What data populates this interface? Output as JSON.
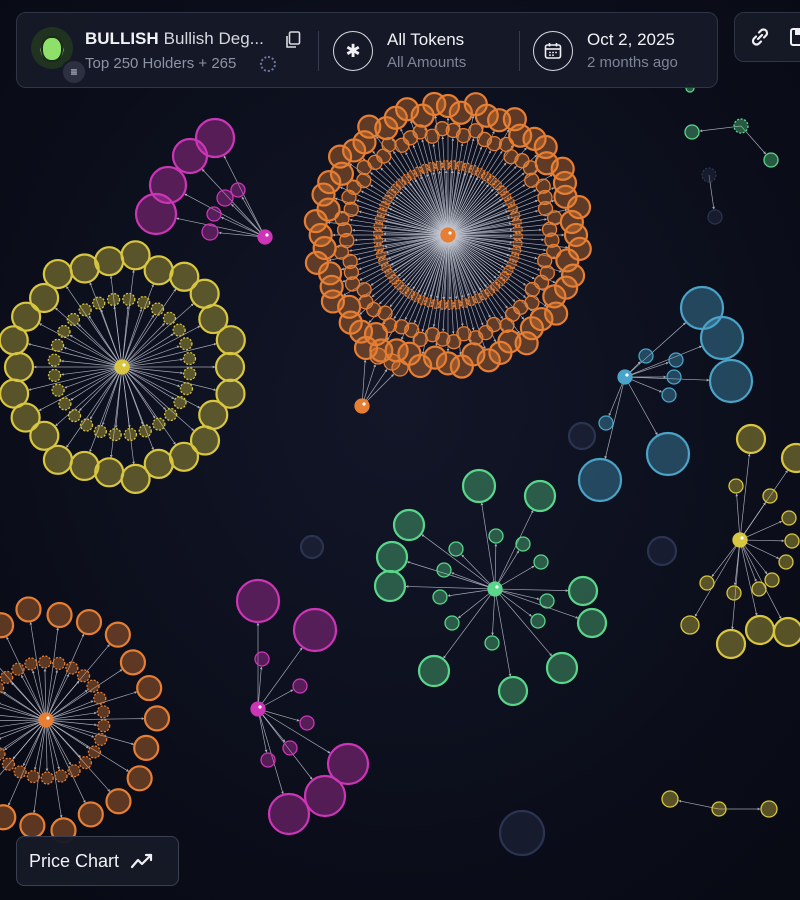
{
  "header": {
    "token_symbol": "BULLISH",
    "token_name": "Bullish Deg...",
    "holders_text": "Top 250 Holders + 265",
    "tokens_filter": {
      "title": "All Tokens",
      "subtitle": "All Amounts"
    },
    "date_filter": {
      "title": "Oct 2, 2025",
      "subtitle": "2 months ago"
    }
  },
  "icons": {
    "copy": "copy-icon",
    "asterisk": "asterisk-icon",
    "calendar": "calendar-icon",
    "link": "link-icon",
    "save": "save-icon",
    "loading": "loading-icon",
    "chain": "solana-icon",
    "chart": "trend-chart-icon"
  },
  "price_chart_button": {
    "label": "Price Chart"
  },
  "colors": {
    "background": "#0b0e1b",
    "orange": "#e67e33",
    "yellow": "#d8c640",
    "magenta": "#cc35b6",
    "green": "#5ad68a",
    "blue": "#4aa3c8",
    "gray": "#2a3350"
  },
  "bubble_clusters": [
    {
      "name": "orange-cluster-top",
      "color": "orange",
      "holders": 120
    },
    {
      "name": "yellow-cluster-left",
      "color": "yellow",
      "holders": 48
    },
    {
      "name": "green-cluster-center",
      "color": "green",
      "holders": 26
    },
    {
      "name": "magenta-cluster-top-left",
      "color": "magenta",
      "holders": 9
    },
    {
      "name": "magenta-cluster-bottom",
      "color": "magenta",
      "holders": 11
    },
    {
      "name": "blue-cluster-right",
      "color": "blue",
      "holders": 11
    },
    {
      "name": "yellow-cluster-right",
      "color": "yellow",
      "holders": 18
    },
    {
      "name": "orange-cluster-bottom-left",
      "color": "orange",
      "holders": 40
    },
    {
      "name": "green-cluster-top-right",
      "color": "green",
      "holders": 3
    },
    {
      "name": "blue-cluster-top-right",
      "color": "blue",
      "holders": 2
    },
    {
      "name": "yellow-cluster-bottom-right",
      "color": "yellow",
      "holders": 3
    }
  ]
}
